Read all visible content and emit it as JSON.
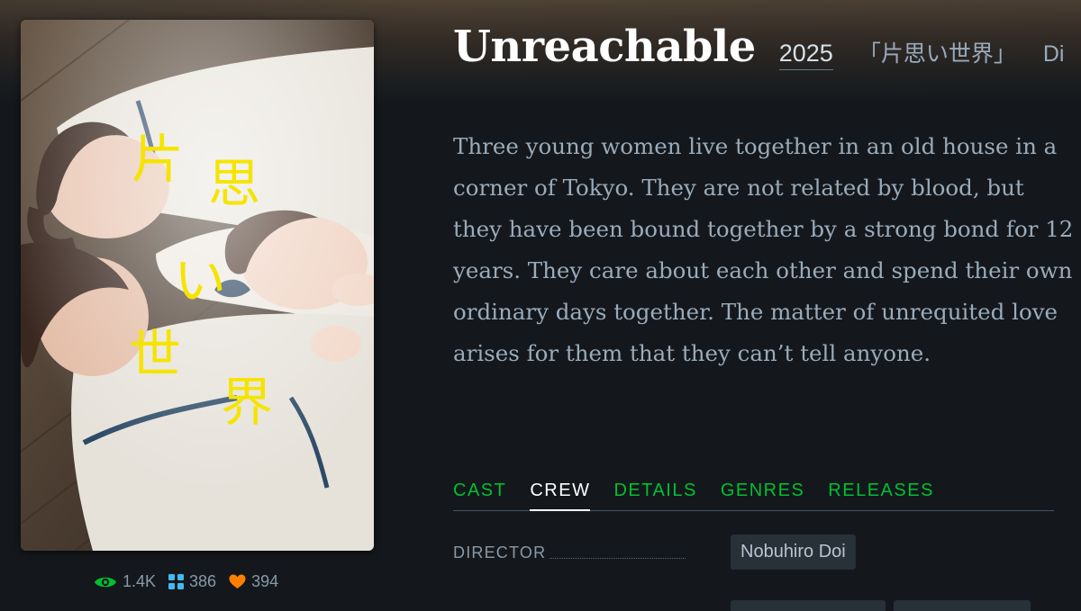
{
  "film": {
    "title": "Unreachable",
    "year": "2025",
    "original_title": "「片思い世界」",
    "directed_by_partial": "Di",
    "synopsis": "Three young women live together in an old house in a corner of Tokyo. They are not related by blood, but they have been bound together by a strong bond for 12 years. They care about each other and spend their own ordinary days together. The matter of unrequited love arises for them that they can’t tell anyone."
  },
  "poster": {
    "title_chars": [
      "片",
      "思",
      "い",
      "世",
      "界"
    ],
    "title_color": "#f5e400"
  },
  "stats": {
    "watched": "1.4K",
    "lists": "386",
    "likes": "394",
    "colors": {
      "watched": "#00c030",
      "lists": "#40bcf4",
      "likes": "#ff8000"
    }
  },
  "tabs": [
    {
      "label": "CAST",
      "active": false
    },
    {
      "label": "CREW",
      "active": true
    },
    {
      "label": "DETAILS",
      "active": false
    },
    {
      "label": "GENRES",
      "active": false
    },
    {
      "label": "RELEASES",
      "active": false
    }
  ],
  "crew": {
    "director_label": "DIRECTOR",
    "director_name": "Nobuhiro Doi"
  },
  "theme": {
    "accent": "#00c030",
    "background": "#14181c"
  }
}
